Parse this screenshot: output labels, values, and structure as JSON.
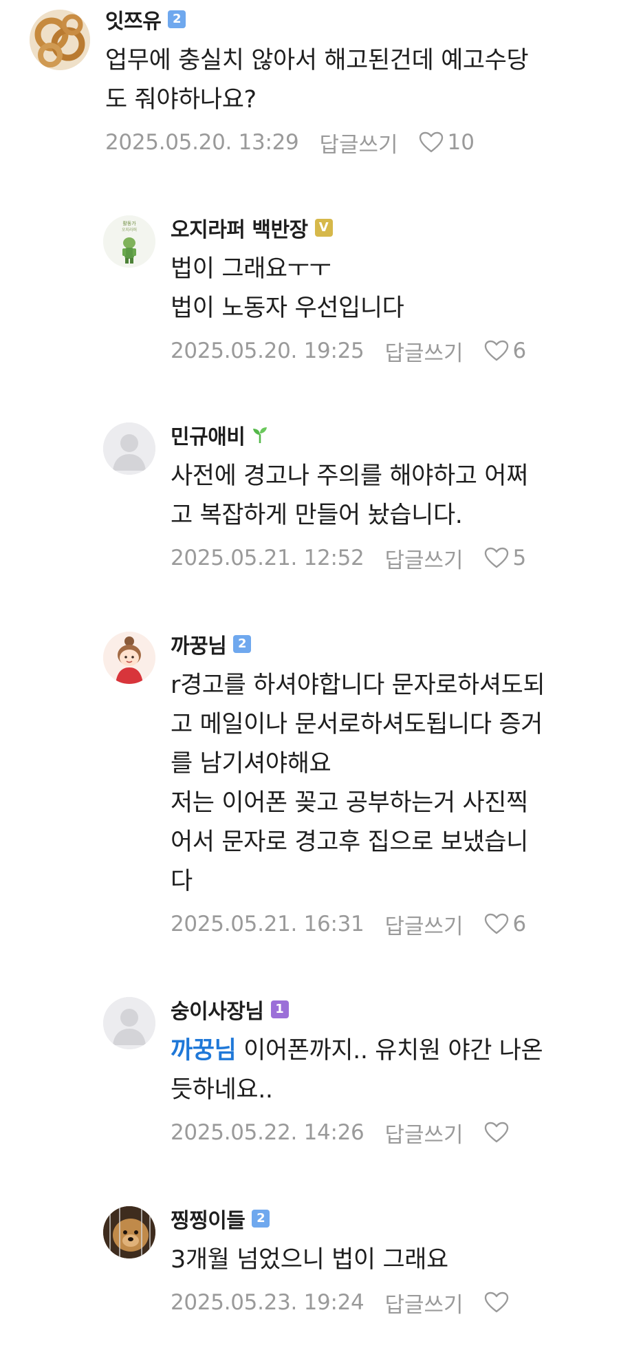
{
  "comments": [
    {
      "author": "잇쯔유",
      "badge": "2",
      "badge_color": "#6fa8ee",
      "text": "업무에 충실치 않아서 해고된건데 예고수당\n도 줘야하나요?",
      "date": "2025.05.20. 13:29",
      "reply_label": "답글쓰기",
      "likes": "10",
      "avatar_icon": "pretzel-snack-avatar"
    },
    {
      "author": "오지라퍼 백반장",
      "badge": "V",
      "badge_color": "#d6b84a",
      "text": "법이 그래요ㅜㅜ\n법이 노동자 우선입니다",
      "date": "2025.05.20. 19:25",
      "reply_label": "답글쓰기",
      "likes": "6",
      "avatar_icon": "green-character-avatar",
      "avatar_caption_1": "활동가",
      "avatar_caption_2": "오지라퍼"
    },
    {
      "author": "민규애비",
      "badge_icon": "sprout-icon",
      "badge_color": "#55b84a",
      "text": "사전에 경고나 주의를 해야하고 어쩌\n고 복잡하게 만들어 놨습니다.",
      "date": "2025.05.21. 12:52",
      "reply_label": "답글쓰기",
      "likes": "5",
      "avatar_icon": "default-user-avatar"
    },
    {
      "author": "까꿍님",
      "badge": "2",
      "badge_color": "#6fa8ee",
      "text": "r경고를 하셔야합니다 문자로하셔도되\n고 메일이나 문서로하셔도됩니다 증거\n를 남기셔야해요\n저는 이어폰 꽂고 공부하는거 사진찍\n어서 문자로 경고후 집으로 보냈습니\n다",
      "date": "2025.05.21. 16:31",
      "reply_label": "답글쓰기",
      "likes": "6",
      "avatar_icon": "cartoon-girl-avatar"
    },
    {
      "author": "숭이사장님",
      "badge": "1",
      "badge_color": "#9b6fd8",
      "mention": "까꿍님",
      "text": " 이어폰까지.. 유치원 야간 나온\n듯하네요..",
      "date": "2025.05.22. 14:26",
      "reply_label": "답글쓰기",
      "likes": "",
      "avatar_icon": "default-user-avatar"
    },
    {
      "author": "찡찡이들",
      "badge": "2",
      "badge_color": "#6fa8ee",
      "text": "3개월 넘었으니 법이 그래요",
      "date": "2025.05.23. 19:24",
      "reply_label": "답글쓰기",
      "likes": "",
      "avatar_icon": "dog-photo-avatar"
    }
  ]
}
